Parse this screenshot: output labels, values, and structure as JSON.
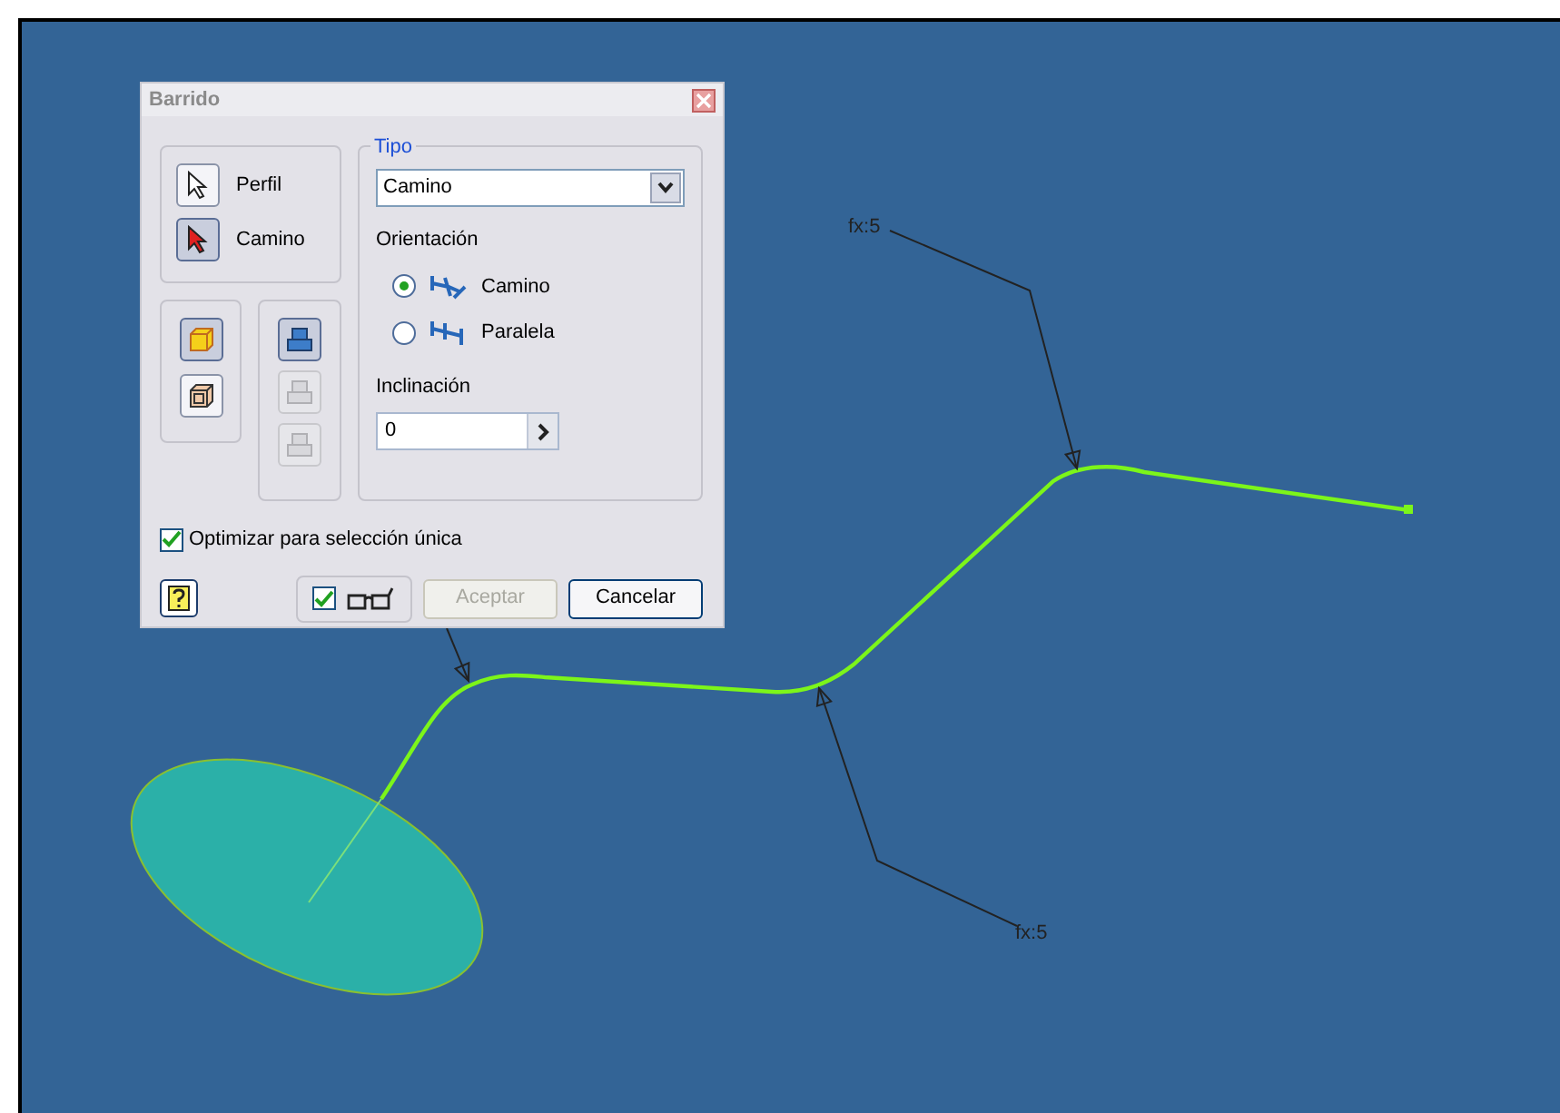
{
  "dialog": {
    "title": "Barrido",
    "selectors": [
      {
        "label": "Perfil",
        "selected": false
      },
      {
        "label": "Camino",
        "selected": true
      }
    ],
    "solid_buttons": [
      {
        "kind": "solid",
        "selected": true
      },
      {
        "kind": "surface",
        "selected": false
      }
    ],
    "operation_buttons": [
      {
        "selected": true,
        "disabled": false
      },
      {
        "selected": false,
        "disabled": true
      },
      {
        "selected": false,
        "disabled": true
      }
    ],
    "type": {
      "legend": "Tipo",
      "value": "Camino"
    },
    "orientation": {
      "label": "Orientación",
      "options": [
        {
          "kind": "path",
          "label": "Camino",
          "selected": true
        },
        {
          "kind": "parallel",
          "label": "Paralela",
          "selected": false
        }
      ]
    },
    "taper": {
      "label": "Inclinación",
      "value": "0"
    },
    "optimize": {
      "label": "Optimizar para selección única",
      "checked": true
    },
    "preview": {
      "checked": true
    },
    "buttons": [
      {
        "label": "Aceptar",
        "disabled": true
      },
      {
        "label": "Cancelar",
        "disabled": false
      }
    ]
  },
  "canvas": {
    "annotations": [
      {
        "text": "fx:5"
      },
      {
        "text": "fx:5"
      }
    ]
  }
}
